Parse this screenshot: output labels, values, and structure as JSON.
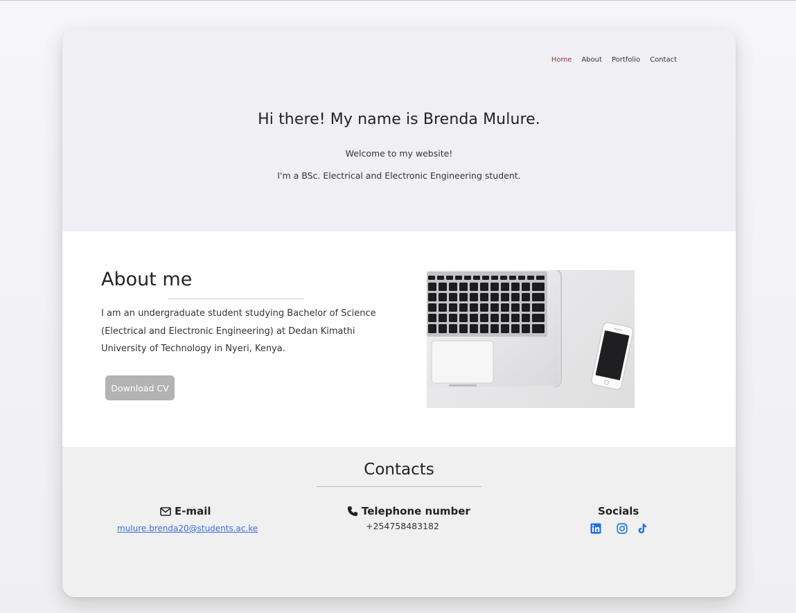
{
  "nav": {
    "items": [
      {
        "label": "Home",
        "active": true
      },
      {
        "label": "About",
        "active": false
      },
      {
        "label": "Portfolio",
        "active": false
      },
      {
        "label": "Contact",
        "active": false
      }
    ]
  },
  "hero": {
    "title": "Hi there! My name is Brenda Mulure.",
    "welcome": "Welcome to my website!",
    "subtitle": "I'm a BSc. Electrical and Electronic Engineering student."
  },
  "about": {
    "heading": "About me",
    "text": "I am an undergraduate student studying Bachelor of Science (Electrical and Electronic Engineering) at Dedan Kimathi University of Technology in Nyeri, Kenya.",
    "cv_button": "Download CV",
    "image_icon": "laptop-phone-photo"
  },
  "contacts": {
    "heading": "Contacts",
    "email": {
      "title": "E-mail",
      "icon": "envelope-icon",
      "value": "mulure.brenda20@students.ac.ke"
    },
    "phone": {
      "title": "Telephone number",
      "icon": "phone-icon",
      "value": "+254758483182"
    },
    "socials": {
      "title": "Socials",
      "icons": [
        "linkedin-icon",
        "instagram-icon",
        "tiktok-icon"
      ]
    }
  },
  "colors": {
    "nav_active": "#8a3b3b",
    "link": "#3b6fd8",
    "social_icons": "#1f6fe0",
    "cv_button": "#b3b3b3"
  }
}
